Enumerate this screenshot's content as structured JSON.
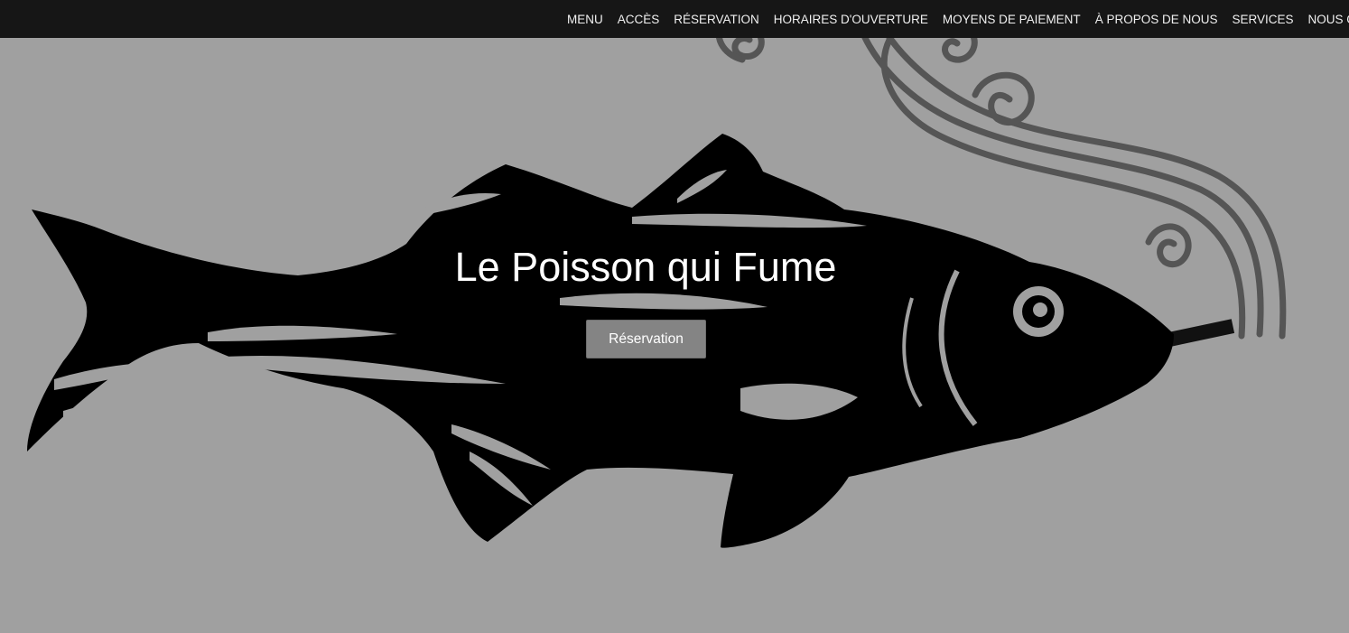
{
  "nav": {
    "items": [
      "MENU",
      "ACCÈS",
      "RÉSERVATION",
      "HORAIRES D'OUVERTURE",
      "MOYENS DE PAIEMENT",
      "À PROPOS DE NOUS",
      "SERVICES",
      "NOUS CONTACTER"
    ]
  },
  "hero": {
    "title": "Le Poisson qui Fume",
    "cta_label": "Réservation",
    "art_icon": "smoking-fish-illustration"
  },
  "colors": {
    "topbar": "#161616",
    "hero_bg": "#a0a0a0",
    "fish": "#000000",
    "smoke": "#555555",
    "button": "#848484"
  }
}
